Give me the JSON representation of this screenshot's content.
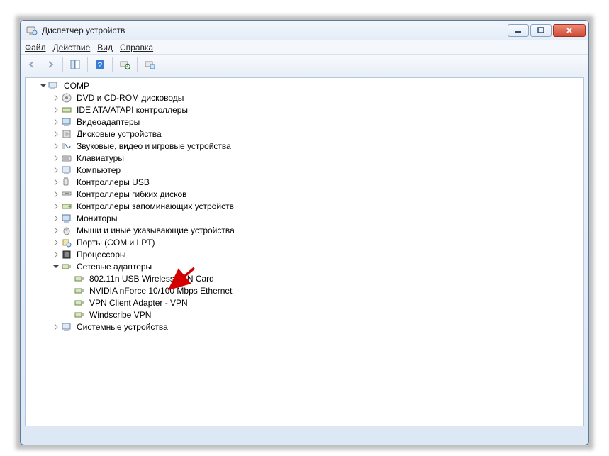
{
  "window": {
    "title": "Диспетчер устройств"
  },
  "menu": {
    "file": "Файл",
    "action": "Действие",
    "view": "Вид",
    "help": "Справка"
  },
  "root": {
    "label": "COMP"
  },
  "categories": [
    {
      "label": "DVD и CD-ROM дисководы"
    },
    {
      "label": "IDE ATA/ATAPI контроллеры"
    },
    {
      "label": "Видеоадаптеры"
    },
    {
      "label": "Дисковые устройства"
    },
    {
      "label": "Звуковые, видео и игровые устройства"
    },
    {
      "label": "Клавиатуры"
    },
    {
      "label": "Компьютер"
    },
    {
      "label": "Контроллеры USB"
    },
    {
      "label": "Контроллеры гибких дисков"
    },
    {
      "label": "Контроллеры запоминающих устройств"
    },
    {
      "label": "Мониторы"
    },
    {
      "label": "Мыши и иные указывающие устройства"
    },
    {
      "label": "Порты (COM и LPT)"
    },
    {
      "label": "Процессоры"
    }
  ],
  "network": {
    "label": "Сетевые адаптеры",
    "children": [
      {
        "label": "802.11n USB Wireless LAN Card"
      },
      {
        "label": "NVIDIA nForce 10/100 Mbps Ethernet"
      },
      {
        "label": "VPN Client Adapter - VPN"
      },
      {
        "label": "Windscribe VPN"
      }
    ]
  },
  "last": {
    "label": "Системные устройства"
  }
}
